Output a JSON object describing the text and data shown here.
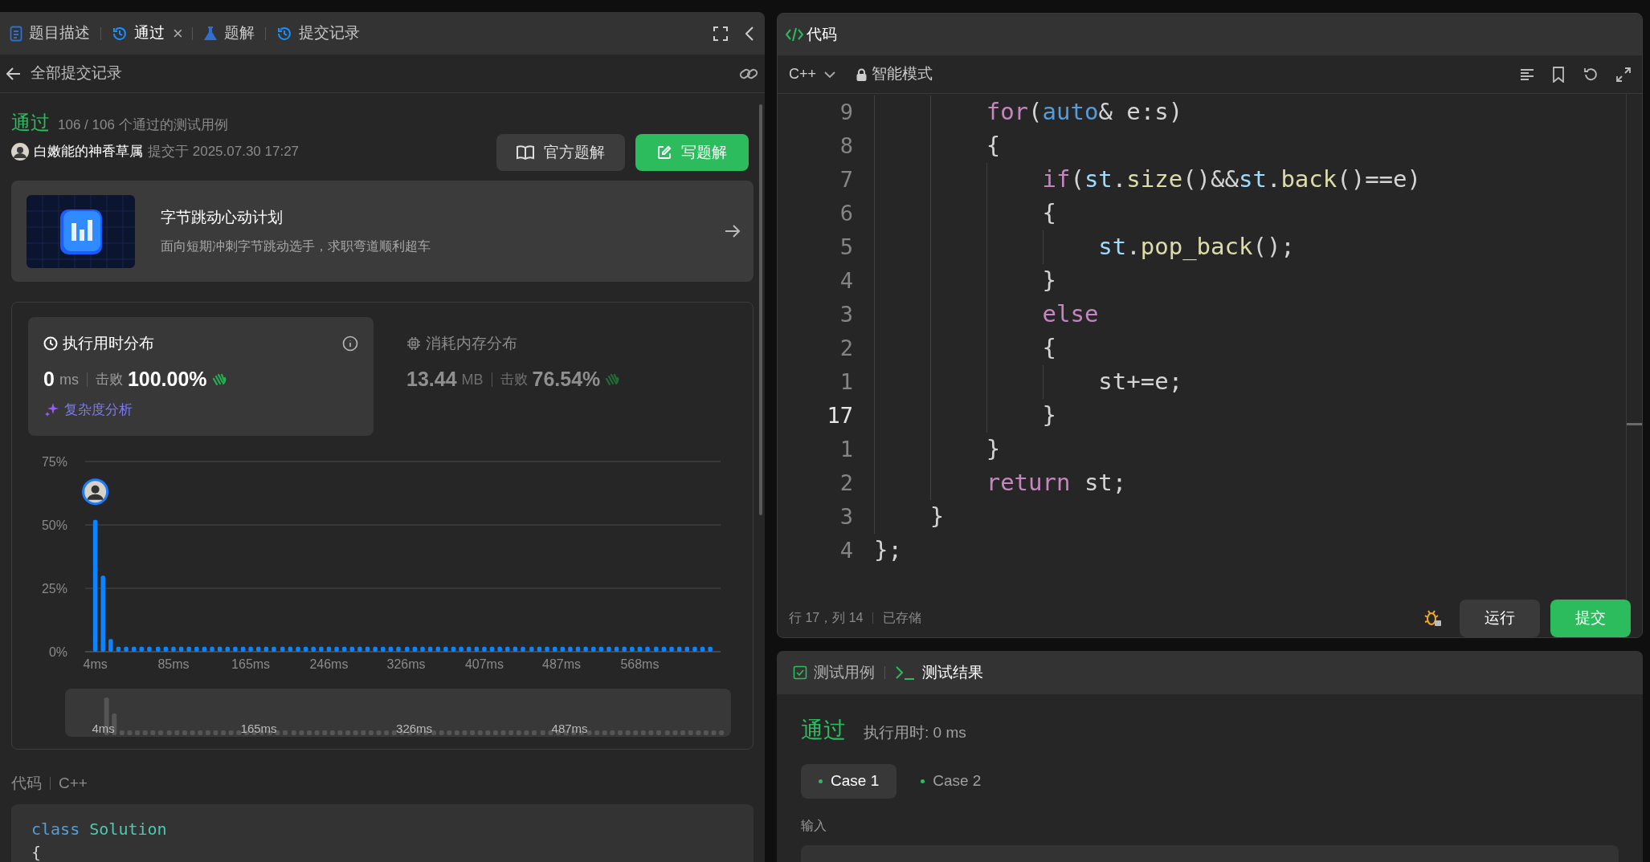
{
  "left_panel": {
    "tabs": [
      {
        "label": "题目描述",
        "selected": false
      },
      {
        "label": "通过",
        "selected": true,
        "close": "×"
      },
      {
        "label": "题解",
        "selected": false
      },
      {
        "label": "提交记录",
        "selected": false
      }
    ],
    "subheader": {
      "title": "全部提交记录"
    },
    "submission": {
      "status": "通过",
      "tests": "106 / 106 个通过的测试用例",
      "user": "白嫩能的神香草属",
      "submitted": "提交于 2025.07.30 17:27",
      "buttons": [
        {
          "label": "官方题解",
          "kind": "secondary"
        },
        {
          "label": "写题解",
          "kind": "primary"
        }
      ]
    },
    "promo": {
      "title": "字节跳动心动计划",
      "subtitle": "面向短期冲刺字节跳动选手，求职弯道顺利超车"
    },
    "stats": [
      {
        "kind": "time",
        "title": "执行用时分布",
        "value": "0",
        "unit": "ms",
        "beat_label": "击败",
        "beat": "100.00%",
        "selected": true,
        "link": "复杂度分析"
      },
      {
        "kind": "memory",
        "title": "消耗内存分布",
        "value": "13.44",
        "unit": "MB",
        "beat_label": "击败",
        "beat": "76.54%",
        "selected": false
      }
    ],
    "chart_data": {
      "type": "bar",
      "xlim": [
        -6.5,
        651.7
      ],
      "ylim": [
        0,
        75
      ],
      "x": [
        4,
        12,
        20,
        28,
        36,
        44,
        52,
        60,
        69,
        77,
        85,
        93,
        101,
        109,
        117,
        125,
        133,
        141,
        149,
        157,
        165,
        173,
        181,
        189,
        198,
        206,
        214,
        222,
        230,
        238,
        246,
        254,
        262,
        270,
        278,
        286,
        294,
        302,
        310,
        318,
        327,
        335,
        343,
        351,
        359,
        367,
        375,
        383,
        391,
        399,
        407,
        415,
        423,
        431,
        439,
        447,
        456,
        464,
        472,
        480,
        488,
        496,
        504,
        512,
        520,
        528,
        536,
        544,
        552,
        560,
        568,
        576,
        585,
        593,
        601,
        609,
        617,
        625,
        633,
        641
      ],
      "values": [
        52,
        30,
        5,
        2,
        2,
        2,
        2,
        2,
        2,
        2,
        2,
        2,
        2,
        2,
        2,
        2,
        2,
        2,
        2,
        2,
        2,
        2,
        2,
        2,
        2,
        2,
        2,
        2,
        2,
        2,
        2,
        2,
        2,
        2,
        2,
        2,
        2,
        2,
        2,
        2,
        2,
        2,
        2,
        2,
        2,
        2,
        2,
        2,
        2,
        2,
        2,
        2,
        2,
        2,
        2,
        2,
        2,
        2,
        2,
        2,
        2,
        2,
        2,
        2,
        2,
        2,
        2,
        2,
        2,
        2,
        2,
        2,
        2,
        2,
        2,
        2,
        2,
        2,
        2,
        2
      ],
      "yticks": [
        {
          "value": 0,
          "label": "0%"
        },
        {
          "value": 25,
          "label": "25%"
        },
        {
          "value": 50,
          "label": "50%"
        },
        {
          "value": 75,
          "label": "75%"
        }
      ],
      "xticks": [
        {
          "value": 4,
          "label": "4ms"
        },
        {
          "value": 85,
          "label": "85ms"
        },
        {
          "value": 165,
          "label": "165ms"
        },
        {
          "value": 246,
          "label": "246ms"
        },
        {
          "value": 326,
          "label": "326ms"
        },
        {
          "value": 407,
          "label": "407ms"
        },
        {
          "value": 487,
          "label": "487ms"
        },
        {
          "value": 568,
          "label": "568ms"
        }
      ]
    },
    "overview_labels": [
      "4ms",
      "165ms",
      "326ms",
      "487ms"
    ],
    "code_header": {
      "label": "代码",
      "language": "C++"
    },
    "code_lines": [
      {
        "tokens": [
          {
            "text": "class",
            "kind": "storage"
          },
          {
            "text": " Solution",
            "kind": "type"
          }
        ]
      },
      {
        "tokens": [
          {
            "text": "{",
            "kind": "plain"
          }
        ]
      }
    ]
  },
  "editor": {
    "title": "代码",
    "language": "C++",
    "mode": "智能模式",
    "lines": [
      {
        "number": "9",
        "current": false,
        "tokens": [
          {
            "text": "        for",
            "kind": "control"
          },
          {
            "text": "(",
            "kind": "plain"
          },
          {
            "text": "auto",
            "kind": "storage"
          },
          {
            "text": "& e:s)",
            "kind": "plain"
          }
        ]
      },
      {
        "number": "8",
        "current": false,
        "tokens": [
          {
            "text": "        {",
            "kind": "plain"
          }
        ]
      },
      {
        "number": "7",
        "current": false,
        "tokens": [
          {
            "text": "            if",
            "kind": "control"
          },
          {
            "text": "(",
            "kind": "plain"
          },
          {
            "text": "st",
            "kind": "variable"
          },
          {
            "text": ".",
            "kind": "plain"
          },
          {
            "text": "size",
            "kind": "function"
          },
          {
            "text": "()&&",
            "kind": "plain"
          },
          {
            "text": "st",
            "kind": "variable"
          },
          {
            "text": ".",
            "kind": "plain"
          },
          {
            "text": "back",
            "kind": "function"
          },
          {
            "text": "()==e)",
            "kind": "plain"
          }
        ]
      },
      {
        "number": "6",
        "current": false,
        "tokens": [
          {
            "text": "            {",
            "kind": "plain"
          }
        ]
      },
      {
        "number": "5",
        "current": false,
        "tokens": [
          {
            "text": "                st",
            "kind": "variable"
          },
          {
            "text": ".",
            "kind": "plain"
          },
          {
            "text": "pop_back",
            "kind": "function"
          },
          {
            "text": "();",
            "kind": "plain"
          }
        ]
      },
      {
        "number": "4",
        "current": false,
        "tokens": [
          {
            "text": "            }",
            "kind": "plain"
          }
        ]
      },
      {
        "number": "3",
        "current": false,
        "tokens": [
          {
            "text": "            else",
            "kind": "control"
          }
        ]
      },
      {
        "number": "2",
        "current": false,
        "tokens": [
          {
            "text": "            {",
            "kind": "plain"
          }
        ]
      },
      {
        "number": "1",
        "current": false,
        "tokens": [
          {
            "text": "                st+=e;",
            "kind": "plain"
          }
        ]
      },
      {
        "number": "17",
        "current": true,
        "tokens": [
          {
            "text": "            }",
            "kind": "plain"
          }
        ]
      },
      {
        "number": "1",
        "current": false,
        "tokens": [
          {
            "text": "        }",
            "kind": "plain"
          }
        ]
      },
      {
        "number": "2",
        "current": false,
        "tokens": [
          {
            "text": "        return",
            "kind": "control"
          },
          {
            "text": " st;",
            "kind": "plain"
          }
        ]
      },
      {
        "number": "3",
        "current": false,
        "tokens": [
          {
            "text": "    }",
            "kind": "plain"
          }
        ]
      },
      {
        "number": "4",
        "current": false,
        "tokens": [
          {
            "text": "};",
            "kind": "plain"
          }
        ]
      }
    ],
    "footer": {
      "position": "行 17，列 14",
      "saved": "已存储",
      "buttons": [
        {
          "label": "运行",
          "kind": "secondary"
        },
        {
          "label": "提交",
          "kind": "primary"
        }
      ]
    }
  },
  "test_panel": {
    "tabs": [
      {
        "label": "测试用例",
        "selected": false
      },
      {
        "label": "测试结果",
        "selected": true
      }
    ],
    "status": "通过",
    "runtime": "执行用时: 0 ms",
    "cases": [
      {
        "label": "Case 1",
        "selected": true
      },
      {
        "label": "Case 2",
        "selected": false
      }
    ],
    "input_label": "输入"
  }
}
